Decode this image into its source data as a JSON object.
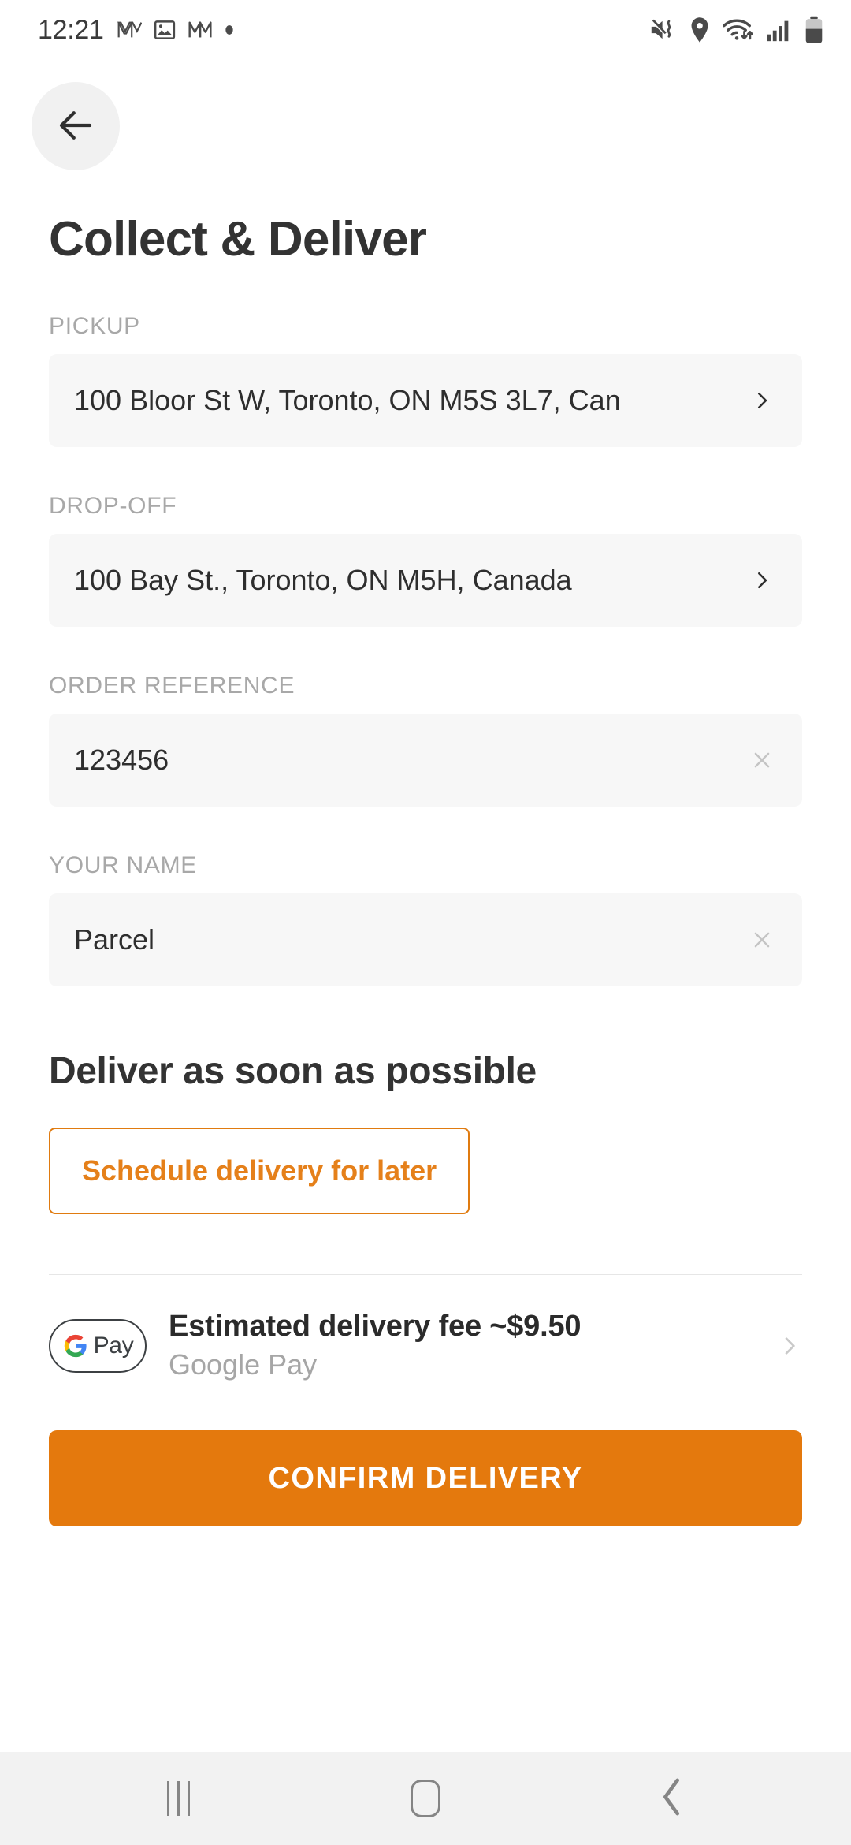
{
  "status_bar": {
    "time": "12:21",
    "left_icons": [
      "gmail-icon",
      "photos-icon",
      "gmail-icon",
      "dot-icon"
    ],
    "right_icons": [
      "mute-vibrate-icon",
      "location-icon",
      "wifi-icon",
      "cellular-signal-icon",
      "battery-icon"
    ]
  },
  "header": {
    "back_label": "Back",
    "title": "Collect & Deliver"
  },
  "fields": [
    {
      "label": "PICKUP",
      "value": "100 Bloor St W, Toronto, ON M5S 3L7, Can",
      "trailing": "chevron-right-icon"
    },
    {
      "label": "DROP-OFF",
      "value": "100 Bay St., Toronto, ON M5H, Canada",
      "trailing": "chevron-right-icon"
    },
    {
      "label": "ORDER REFERENCE",
      "value": "123456",
      "trailing": "clear-icon"
    },
    {
      "label": "YOUR NAME",
      "value": "Parcel",
      "trailing": "clear-icon"
    }
  ],
  "delivery": {
    "heading": "Deliver as soon as possible",
    "schedule_label": "Schedule delivery for later"
  },
  "payment": {
    "badge_text": "Pay",
    "fee_text": "Estimated delivery fee ~$9.50",
    "method": "Google Pay",
    "chevron": "chevron-right-icon"
  },
  "confirm": {
    "label": "CONFIRM DELIVERY"
  },
  "nav_bar": {
    "recents_label": "Recents",
    "home_label": "Home",
    "back_label": "Back"
  },
  "colors": {
    "accent": "#e4790d",
    "accent_border": "#e07b10",
    "field_bg": "#f7f7f7",
    "label_gray": "#a8a8a8",
    "title_dark": "#333333"
  }
}
